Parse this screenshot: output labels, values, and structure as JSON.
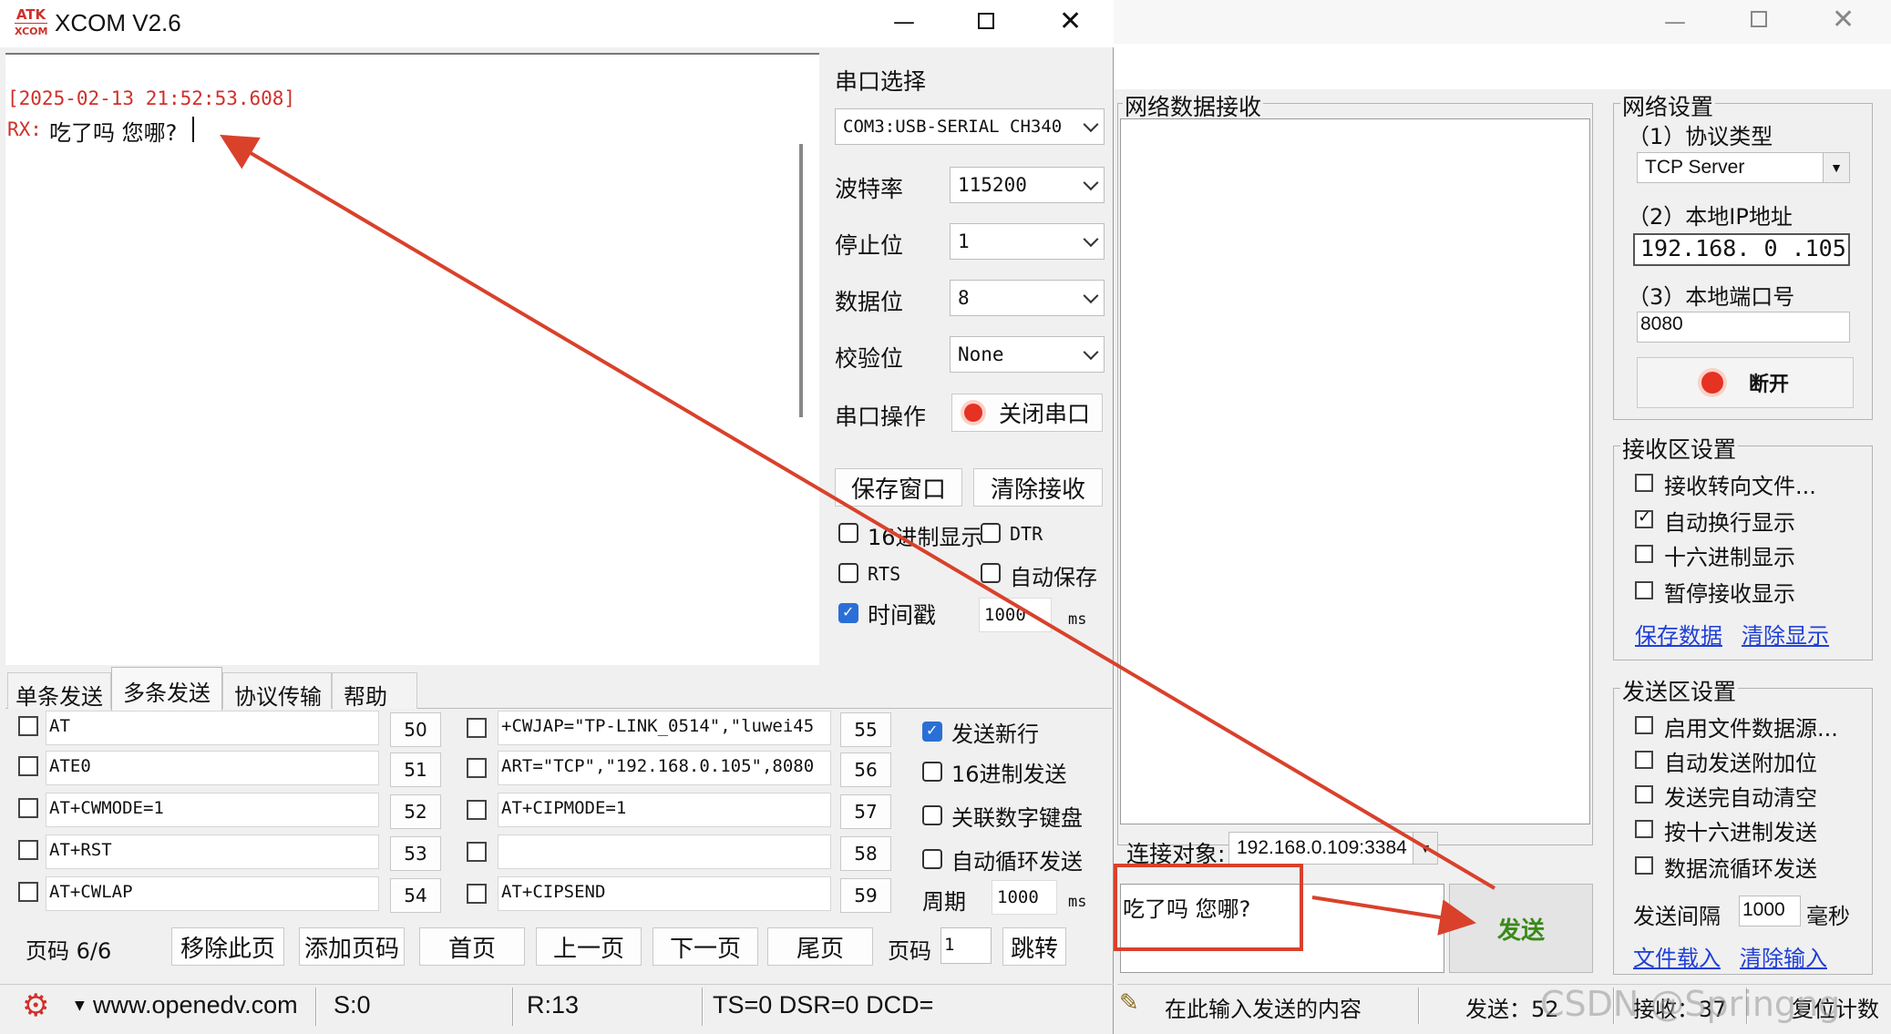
{
  "xcom": {
    "title": "XCOM V2.6",
    "logo_top": "ATK",
    "logo_bottom": "XCOM",
    "receive": {
      "timestamp": "[2025-02-13 21:52:53.608]",
      "rx_prefix": "RX:",
      "rx_text": "吃了吗 您哪?"
    },
    "port_select_label": "串口选择",
    "port_value": "COM3:USB-SERIAL CH340",
    "baud_label": "波特率",
    "baud_value": "115200",
    "stop_label": "停止位",
    "stop_value": "1",
    "data_label": "数据位",
    "data_value": "8",
    "parity_label": "校验位",
    "parity_value": "None",
    "port_op_label": "串口操作",
    "close_port_button": "关闭串口",
    "save_window_button": "保存窗口",
    "clear_receive_button": "清除接收",
    "hex_display_label": "16进制显示",
    "dtr_label": "DTR",
    "rts_label": "RTS",
    "auto_save_label": "自动保存",
    "timestamp_label": "时间戳",
    "timestamp_ms_value": "1000",
    "ms_unit": "ms",
    "tabs": [
      "单条发送",
      "多条发送",
      "协议传输",
      "帮助"
    ],
    "commands_left": [
      {
        "text": "AT",
        "num": "50"
      },
      {
        "text": "ATE0",
        "num": "51"
      },
      {
        "text": "AT+CWMODE=1",
        "num": "52"
      },
      {
        "text": "AT+RST",
        "num": "53"
      },
      {
        "text": "AT+CWLAP",
        "num": "54"
      }
    ],
    "commands_right": [
      {
        "text": "+CWJAP=\"TP-LINK_0514\",\"luwei45",
        "num": "55"
      },
      {
        "text": "ART=\"TCP\",\"192.168.0.105\",8080",
        "num": "56"
      },
      {
        "text": "AT+CIPMODE=1",
        "num": "57"
      },
      {
        "text": "",
        "num": "58"
      },
      {
        "text": "AT+CIPSEND",
        "num": "59"
      }
    ],
    "send_newline_label": "发送新行",
    "hex_send_label": "16进制发送",
    "link_keypad_label": "关联数字键盘",
    "auto_loop_label": "自动循环发送",
    "period_label": "周期",
    "period_value": "1000",
    "page_label": "页码 6/6",
    "remove_page_button": "移除此页",
    "add_page_button": "添加页码",
    "first_button": "首页",
    "prev_button": "上一页",
    "next_button": "下一页",
    "last_button": "尾页",
    "page_input_label": "页码",
    "page_input_value": "1",
    "jump_button": "跳转",
    "status_url": "www.openedv.com",
    "status_s": "S:0",
    "status_r": "R:13",
    "status_lines": "TS=0 DSR=0 DCD="
  },
  "net": {
    "receive_group_label": "网络数据接收",
    "settings_group_label": "网络设置",
    "protocol_label": "（1）协议类型",
    "protocol_value": "TCP Server",
    "ip_label": "（2）本地IP地址",
    "ip_value": "192.168. 0 .105",
    "port_label": "（3）本地端口号",
    "port_value": "8080",
    "disconnect_button": "断开",
    "recv_settings_label": "接收区设置",
    "recv_options": [
      {
        "label": "接收转向文件...",
        "checked": false
      },
      {
        "label": "自动换行显示",
        "checked": true
      },
      {
        "label": "十六进制显示",
        "checked": false
      },
      {
        "label": "暂停接收显示",
        "checked": false
      }
    ],
    "save_data_link": "保存数据",
    "clear_display_link": "清除显示",
    "send_settings_label": "发送区设置",
    "send_options": [
      {
        "label": "启用文件数据源...",
        "checked": false
      },
      {
        "label": "自动发送附加位",
        "checked": false
      },
      {
        "label": "发送完自动清空",
        "checked": false
      },
      {
        "label": "按十六进制发送",
        "checked": false
      },
      {
        "label": "数据流循环发送",
        "checked": false
      }
    ],
    "send_interval_label": "发送间隔",
    "send_interval_value": "1000",
    "send_interval_unit": "毫秒",
    "file_load_link": "文件载入",
    "clear_input_link": "清除输入",
    "connect_target_label": "连接对象:",
    "connect_target_value": "192.168.0.109:3384",
    "send_text": "吃了吗 您哪?",
    "send_button": "发送",
    "status_hint": "在此输入发送的内容",
    "status_sent": "发送：52",
    "status_recv": "接收：37",
    "status_reset": "复位计数",
    "watermark": "CSDN @Springng"
  },
  "colors": {
    "annotation": "#d9412b",
    "send_button_text": "#3a8a1a",
    "timestamp": "#d0302a",
    "link": "#1f3fd6",
    "check_blue": "#2a6fd6"
  }
}
